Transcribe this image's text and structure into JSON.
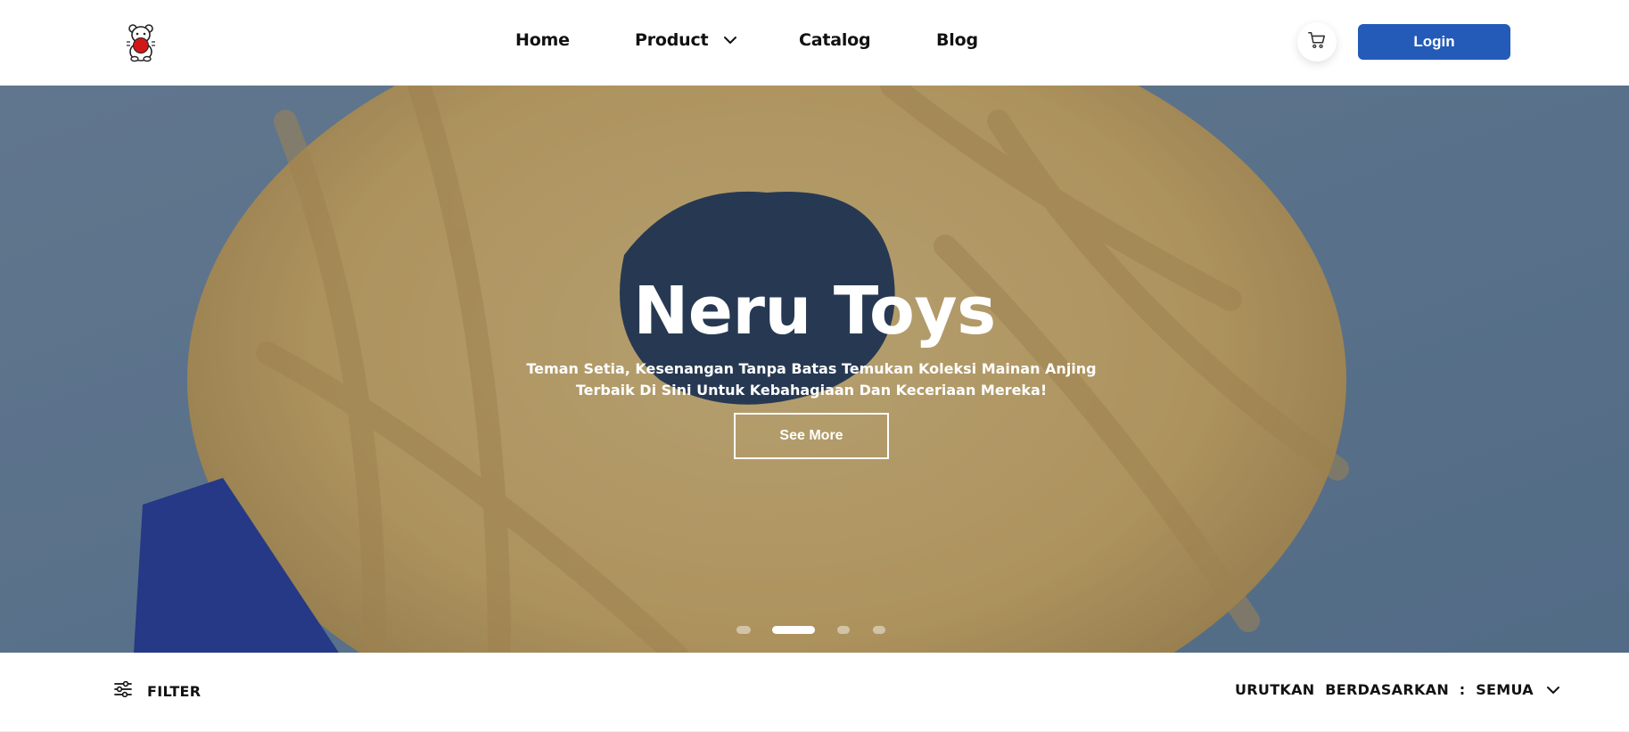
{
  "brand": {
    "logo_icon": "bear-with-ball-logo",
    "accent": "#245bb8"
  },
  "nav": {
    "home": "Home",
    "product": "Product",
    "catalog": "Catalog",
    "blog": "Blog"
  },
  "header": {
    "cart_icon": "cart-icon",
    "login_label": "Login"
  },
  "hero": {
    "title": "Neru Toys",
    "subtitle": "Teman Setia, Kesenangan Tanpa Batas Temukan Koleksi Mainan Anjing Terbaik Di Sini Untuk Kebahagiaan Dan Keceriaan Mereka!",
    "cta_label": "See More",
    "slides_total": 4,
    "active_slide": 2
  },
  "toolbar": {
    "filter_label": "FILTER",
    "sort_label": "URUTKAN  BERDASARKAN  :  SEMUA"
  }
}
